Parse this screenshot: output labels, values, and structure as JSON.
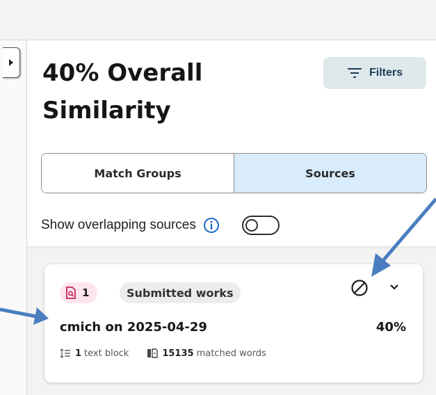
{
  "colors": {
    "accent": "#1768c7",
    "arrow": "#4a7ec0",
    "tab_active_bg": "#d9ecfb",
    "badge_pink": "#fde5ee",
    "badge_icon": "#c4225c"
  },
  "collapse_toggle": {
    "icon": "chevron-right-icon"
  },
  "summary": {
    "title": "40% Overall Similarity"
  },
  "filters": {
    "label": "Filters",
    "icon": "filter-icon"
  },
  "tabs": [
    {
      "label": "Match Groups",
      "active": false
    },
    {
      "label": "Sources",
      "active": true
    }
  ],
  "overlap": {
    "label": "Show overlapping sources",
    "info_icon": "info-icon",
    "toggle_on": false
  },
  "sources": [
    {
      "rank": "1",
      "type_label": "Submitted works",
      "name": "cmich on 2025-04-29",
      "percent": "40%",
      "text_blocks": "1",
      "text_blocks_label": "text block",
      "matched_words": "15135",
      "matched_words_label": "matched words",
      "icons": [
        "submitted-doc-icon",
        "exclude-icon",
        "chevron-down-icon",
        "text-block-icon",
        "matched-words-icon"
      ]
    }
  ]
}
